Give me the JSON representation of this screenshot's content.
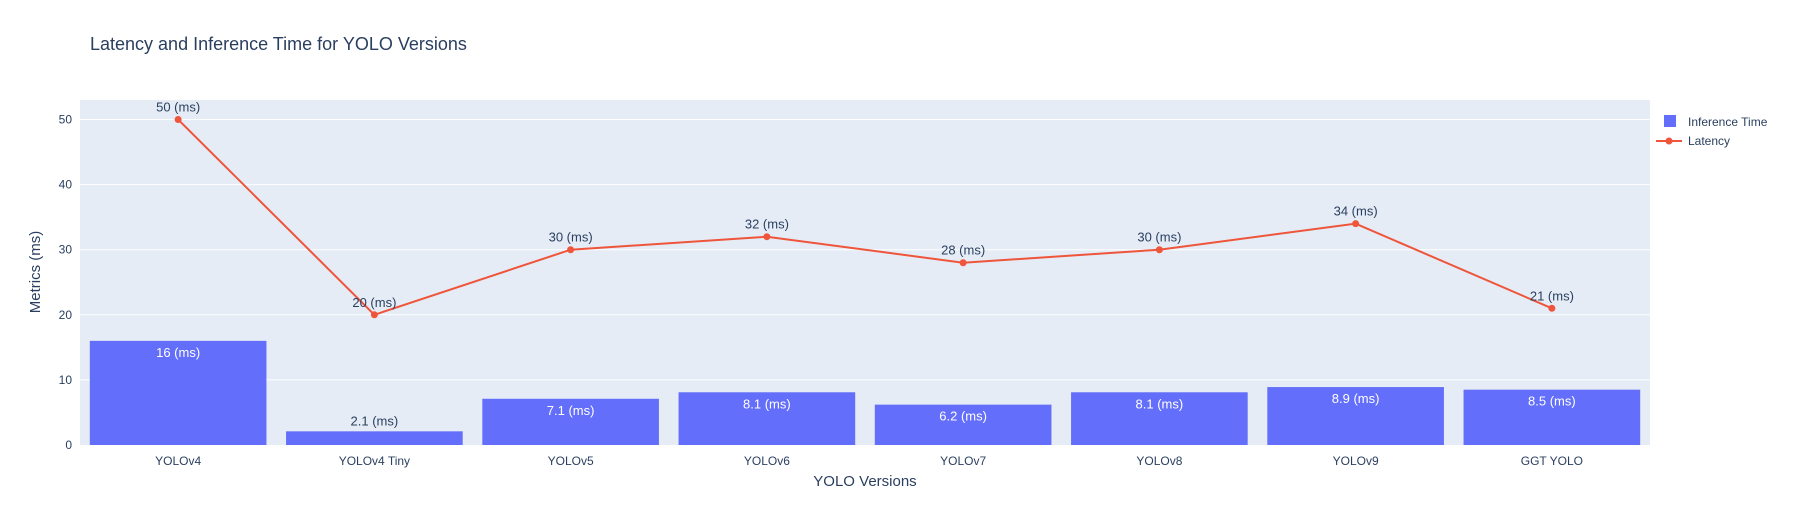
{
  "chart_data": {
    "type": "bar",
    "title": "Latency and Inference Time for YOLO Versions",
    "xlabel": "YOLO Versions",
    "ylabel": "Metrics (ms)",
    "ylim": [
      0,
      53
    ],
    "yticks": [
      0,
      10,
      20,
      30,
      40,
      50
    ],
    "grid": true,
    "legend_position": "top-right",
    "categories": [
      "YOLOv4",
      "YOLOv4 Tiny",
      "YOLOv5",
      "YOLOv6",
      "YOLOv7",
      "YOLOv8",
      "YOLOv9",
      "GGT YOLO"
    ],
    "series": [
      {
        "name": "Inference Time",
        "type": "bar",
        "color": "#636efa",
        "values": [
          16,
          2.1,
          7.1,
          8.1,
          6.2,
          8.1,
          8.9,
          8.5
        ],
        "labels": [
          "16 (ms)",
          "2.1 (ms)",
          "7.1 (ms)",
          "8.1 (ms)",
          "6.2 (ms)",
          "8.1 (ms)",
          "8.9 (ms)",
          "8.5 (ms)"
        ]
      },
      {
        "name": "Latency",
        "type": "line",
        "color": "#ef553b",
        "values": [
          50,
          20,
          30,
          32,
          28,
          30,
          34,
          21
        ],
        "labels": [
          "50 (ms)",
          "20 (ms)",
          "30 (ms)",
          "32 (ms)",
          "28 (ms)",
          "30 (ms)",
          "34 (ms)",
          "21 (ms)"
        ]
      }
    ],
    "colors": {
      "plot_background": "#e5ecf6",
      "gridline": "#ffffff",
      "text": "#2a3f5f"
    }
  }
}
